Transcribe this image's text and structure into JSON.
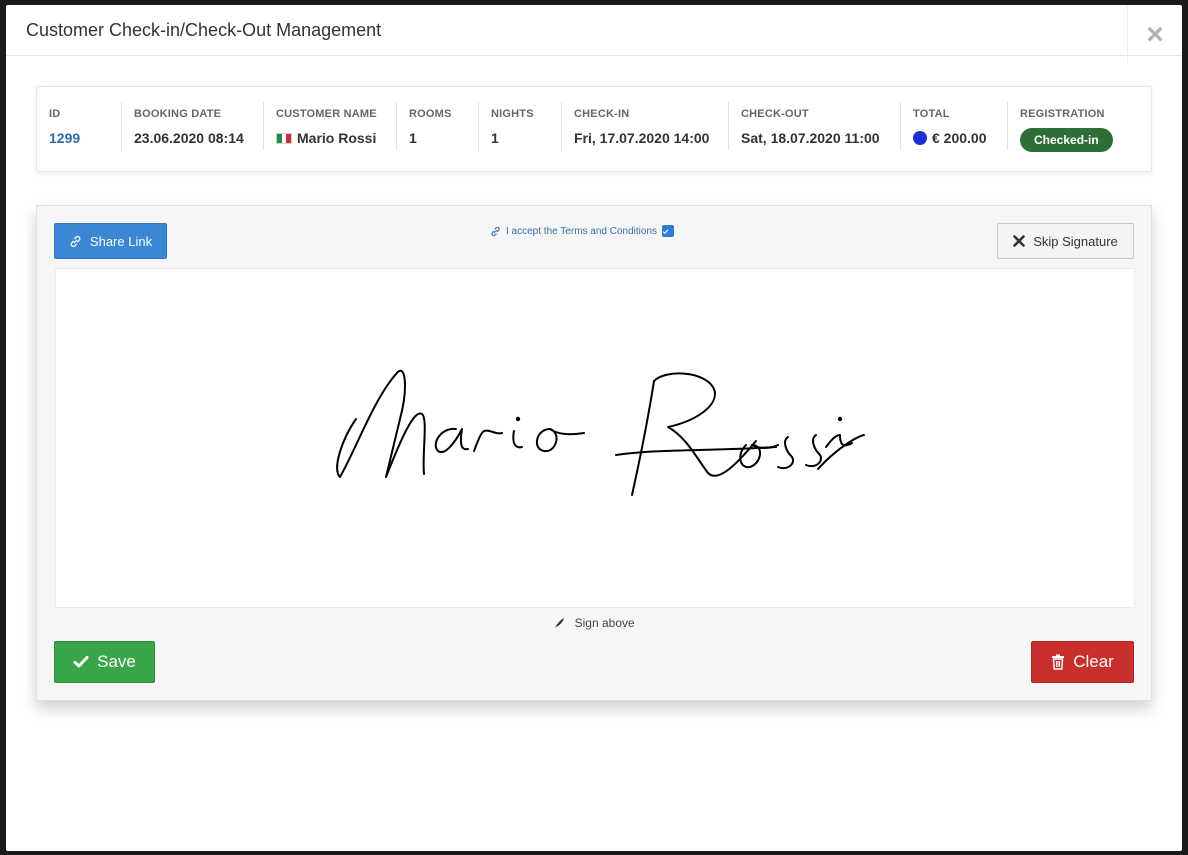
{
  "modal": {
    "title": "Customer Check-in/Check-Out Management",
    "close_label": "×"
  },
  "summary": {
    "id": {
      "label": "ID",
      "value": "1299"
    },
    "booking_date": {
      "label": "BOOKING DATE",
      "value": "23.06.2020 08:14"
    },
    "customer_name": {
      "label": "CUSTOMER NAME",
      "value": "Mario Rossi",
      "flag": "italy-flag-icon"
    },
    "rooms": {
      "label": "ROOMS",
      "value": "1"
    },
    "nights": {
      "label": "NIGHTS",
      "value": "1"
    },
    "check_in": {
      "label": "CHECK-IN",
      "value": "Fri, 17.07.2020 14:00"
    },
    "check_out": {
      "label": "CHECK-OUT",
      "value": "Sat, 18.07.2020 11:00"
    },
    "total": {
      "label": "TOTAL",
      "value": "€ 200.00",
      "status_dot_color": "#1a2fd6"
    },
    "registration": {
      "label": "REGISTRATION",
      "badge": "Checked-in",
      "badge_color": "#2f6e34"
    }
  },
  "signature": {
    "share_label": "Share Link",
    "terms_text": "I accept the Terms and Conditions",
    "terms_checked": true,
    "skip_label": "Skip Signature",
    "signed_name": "Mario Rossi",
    "hint": "Sign above",
    "save_label": "Save",
    "clear_label": "Clear"
  },
  "colors": {
    "primary": "#3a87d6",
    "success": "#3aa64a",
    "danger": "#c9302c",
    "link": "#2b6cb0"
  }
}
